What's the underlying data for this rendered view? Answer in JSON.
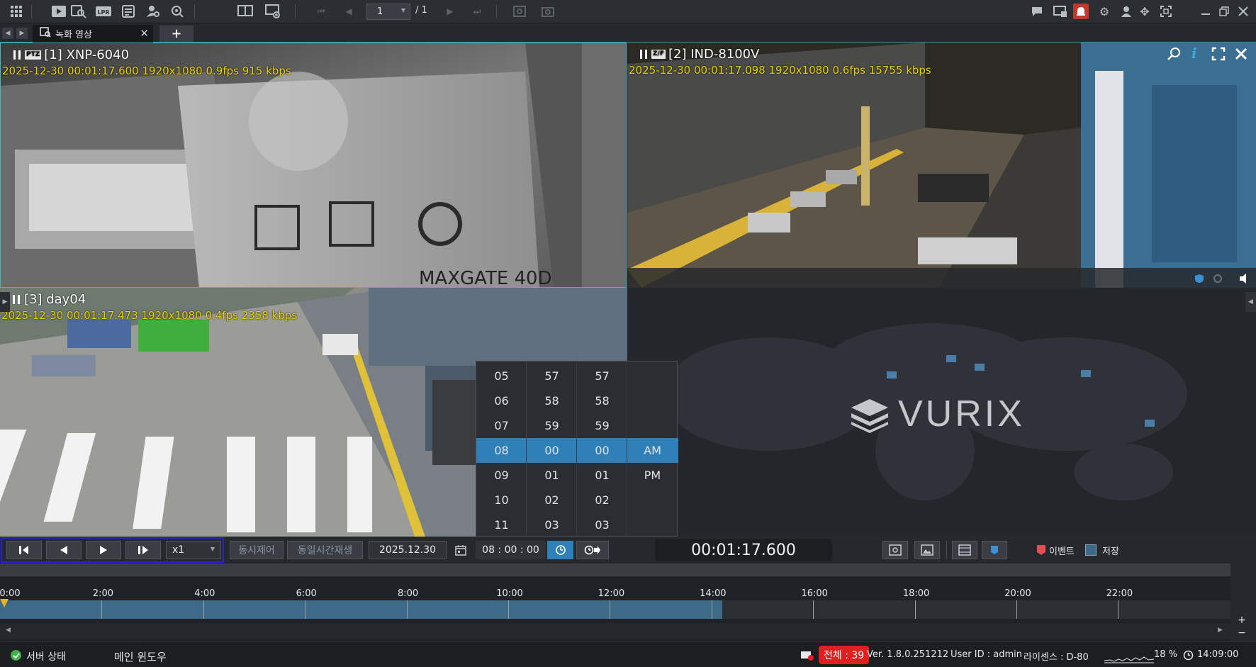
{
  "toolbar": {
    "page_current": "1",
    "page_total": "/ 1"
  },
  "tabs": [
    {
      "label": "녹화 영상"
    }
  ],
  "panes": [
    {
      "title": "[1] XNP-6040",
      "badge": "PTZ",
      "info": "2025-12-30 00:01:17.600 1920x1080  0.9fps 915 kbps"
    },
    {
      "title": "[2] IND-8100V",
      "badge": "Z/F",
      "info": "2025-12-30 00:01:17.098 1920x1080  0.6fps 15755 kbps"
    },
    {
      "title": "[3] day04",
      "badge": "",
      "info": "2025-12-30 00:01:17.473 1920x1080  0.4fps 2358 kbps"
    }
  ],
  "logo": {
    "text": "VURIX"
  },
  "time_picker": {
    "hours": [
      "05",
      "06",
      "07",
      "08",
      "09",
      "10",
      "11"
    ],
    "minutes": [
      "57",
      "58",
      "59",
      "00",
      "01",
      "02",
      "03"
    ],
    "seconds": [
      "57",
      "58",
      "59",
      "00",
      "01",
      "02",
      "03"
    ],
    "ampm": [
      "AM",
      "PM"
    ],
    "selected_index": 3
  },
  "controls": {
    "speed": "x1",
    "sync_control": "동시제어",
    "sync_play": "동일시간재생",
    "date": "2025.12.30",
    "time": "08 : 00 : 00",
    "current_time": "00:01:17.600",
    "legend_event": "이벤트",
    "legend_storage": "저장"
  },
  "timeline": {
    "labels": [
      "0:00",
      "2:00",
      "4:00",
      "6:00",
      "8:00",
      "10:00",
      "12:00",
      "14:00",
      "16:00",
      "18:00",
      "20:00",
      "22:00"
    ],
    "recorded_until_fraction": 0.587
  },
  "status": {
    "server": "서버 상태",
    "main_window": "메인 윈도우",
    "total": "전체 : 39",
    "version": "Ver. 1.8.0.251212",
    "user": "User ID : admin",
    "license": "라이센스 : D-80",
    "cpu": "18 %",
    "clock": "14:09:00"
  },
  "colors": {
    "accent": "#2f7fb8",
    "alert": "#e02020",
    "info_text": "#e8d300"
  }
}
